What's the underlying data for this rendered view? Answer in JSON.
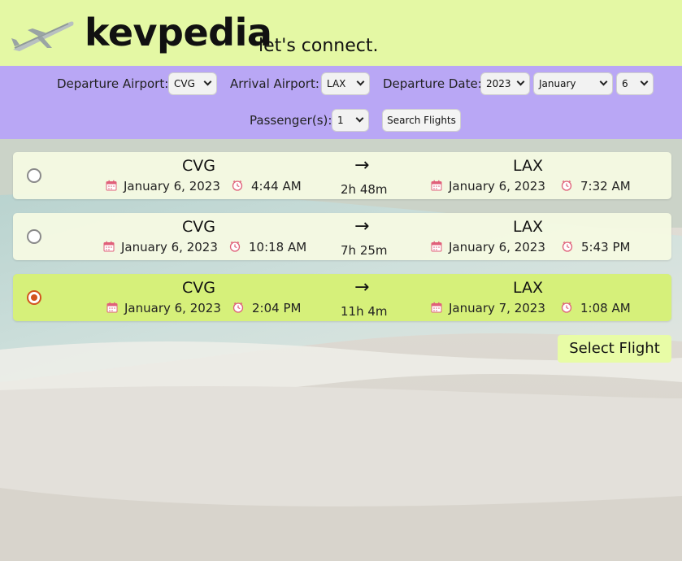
{
  "header": {
    "brand": "kevpedia",
    "tagline": "let's connect.",
    "logo_icon": "airplane-icon"
  },
  "search": {
    "departure_label": "Departure Airport:",
    "departure_value": "CVG",
    "arrival_label": "Arrival Airport:",
    "arrival_value": "LAX",
    "date_label": "Departure Date:",
    "year_value": "2023",
    "month_value": "January",
    "day_value": "6",
    "passengers_label": "Passenger(s):",
    "passengers_value": "1",
    "search_button": "Search Flights"
  },
  "flights": [
    {
      "dep_code": "CVG",
      "dep_date": "January 6, 2023",
      "dep_time": "4:44 AM",
      "arr_code": "LAX",
      "arr_date": "January 6, 2023",
      "arr_time": "7:32 AM",
      "duration": "2h 48m",
      "arrow": "→",
      "selected": false
    },
    {
      "dep_code": "CVG",
      "dep_date": "January 6, 2023",
      "dep_time": "10:18 AM",
      "arr_code": "LAX",
      "arr_date": "January 6, 2023",
      "arr_time": "5:43 PM",
      "duration": "7h 25m",
      "arrow": "→",
      "selected": false
    },
    {
      "dep_code": "CVG",
      "dep_date": "January 6, 2023",
      "dep_time": "2:04 PM",
      "arr_code": "LAX",
      "arr_date": "January 7, 2023",
      "arr_time": "1:08 AM",
      "duration": "11h 4m",
      "arrow": "→",
      "selected": true
    }
  ],
  "select_button": "Select Flight",
  "colors": {
    "header_bg": "#e4f8a4",
    "searchbar_bg": "#b9a7f5",
    "selected_row": "#d6f07a",
    "radio_accent": "#d2541e",
    "icon_pink": "#e0607a"
  }
}
